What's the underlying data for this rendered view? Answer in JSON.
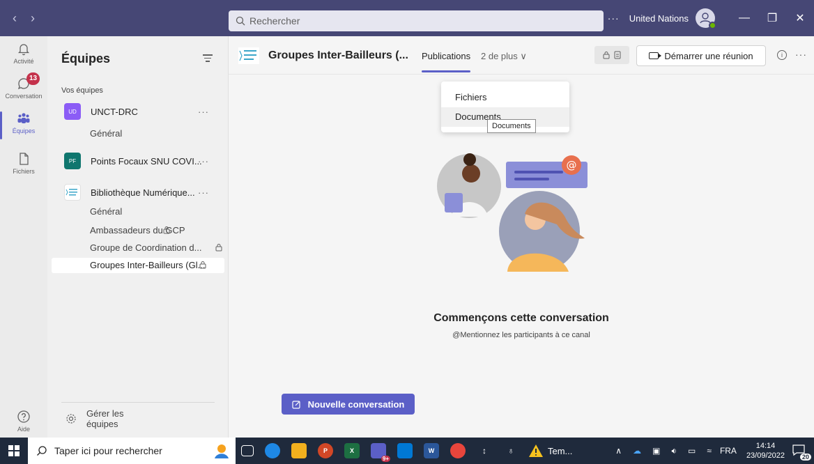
{
  "titlebar": {
    "search_placeholder": "Rechercher",
    "more": "···",
    "org_name": "United Nations",
    "minimize": "—",
    "maximize": "❐",
    "close": "✕"
  },
  "rail": {
    "activity": "Activité",
    "chat": "Conversation",
    "chat_badge": "13",
    "teams": "Équipes",
    "files": "Fichiers",
    "help": "Aide"
  },
  "panel": {
    "title": "Équipes",
    "section": "Vos équipes",
    "teams": [
      {
        "initials": "UD",
        "name": "UNCT-DRC",
        "color": "#8b5cf6"
      },
      {
        "initials": "PF",
        "name": "Points Focaux SNU COVI...",
        "color": "#0f766e"
      },
      {
        "initials": "",
        "name": "Bibliothèque Numérique...",
        "color": "#ffffff"
      }
    ],
    "channels_team1": [
      "Général"
    ],
    "channels_team3": [
      "Général",
      "Ambassadeurs du GCP",
      "Groupe de Coordination d...",
      "Groupes Inter-Bailleurs (Gl..."
    ],
    "manage_line1": "Gérer les",
    "manage_line2": "équipes"
  },
  "header": {
    "channel_title": "Groupes Inter-Bailleurs (...",
    "tab_active": "Publications",
    "tab_more": "2 de plus",
    "meet_button": "Démarrer une réunion"
  },
  "dropdown": {
    "items": [
      "Fichiers",
      "Documents"
    ],
    "tooltip": "Documents"
  },
  "empty_state": {
    "title": "Commençons cette conversation",
    "subtitle": "@Mentionnez les participants à ce canal"
  },
  "new_conversation": "Nouvelle conversation",
  "taskbar": {
    "search_placeholder": "Taper ici pour rechercher",
    "teams_badge": "9+",
    "app_label": "Tem...",
    "language": "FRA",
    "time": "14:14",
    "date": "23/09/2022",
    "notifications": "20"
  },
  "colors": {
    "titlebar": "#464775",
    "accent": "#5b5fc7",
    "badge": "#c4314b"
  }
}
